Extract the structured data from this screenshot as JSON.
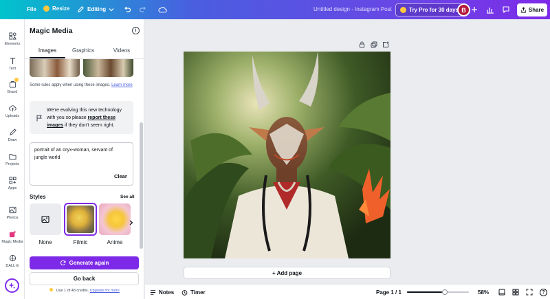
{
  "topbar": {
    "file_label": "File",
    "resize_label": "Resize",
    "editing_label": "Editing",
    "design_title": "Untitled design - Instagram Post",
    "try_pro_label": "Try Pro for 30 days",
    "avatar_letter": "B",
    "share_label": "Share"
  },
  "rail": {
    "items": [
      {
        "label": "Elements",
        "icon": "elements-icon"
      },
      {
        "label": "Text",
        "icon": "text-icon"
      },
      {
        "label": "Brand",
        "icon": "brand-icon"
      },
      {
        "label": "Uploads",
        "icon": "upload-icon"
      },
      {
        "label": "Draw",
        "icon": "draw-icon"
      },
      {
        "label": "Projects",
        "icon": "folder-icon"
      },
      {
        "label": "Apps",
        "icon": "apps-icon"
      },
      {
        "label": "Photos",
        "icon": "photo-icon"
      },
      {
        "label": "Magic Media",
        "icon": "magic-media-icon"
      },
      {
        "label": "DALL·E",
        "icon": "dalle-icon"
      }
    ]
  },
  "panel": {
    "title": "Magic Media",
    "tabs": [
      "Images",
      "Graphics",
      "Videos"
    ],
    "active_tab": "Images",
    "rules_text": "Some rules apply when using these images.",
    "learn_more_label": "Learn more",
    "notice_prefix": "We're evolving this new technology with you so please",
    "notice_link": "report these images",
    "notice_suffix": "if they don't seem right.",
    "prompt_value": "portrait of an oryx-woman, servant of jungle world",
    "clear_label": "Clear",
    "styles_heading": "Styles",
    "see_all_label": "See all",
    "styles": [
      {
        "label": "None"
      },
      {
        "label": "Filmic"
      },
      {
        "label": "Anime"
      }
    ],
    "selected_style": "Filmic",
    "generate_again_label": "Generate again",
    "go_back_label": "Go back",
    "credits_prefix": "Use 1 of 48 credits.",
    "credits_link": "Upgrade for more"
  },
  "canvas": {
    "add_page_label": "+ Add page"
  },
  "bottombar": {
    "notes_label": "Notes",
    "timer_label": "Timer",
    "page_label": "Page 1 / 1",
    "zoom_value": 58,
    "zoom_label": "58%"
  },
  "colors": {
    "accent": "#7d2ae8",
    "avatar_bg": "#b3173b",
    "magic_media_accent": "#e2367f"
  }
}
